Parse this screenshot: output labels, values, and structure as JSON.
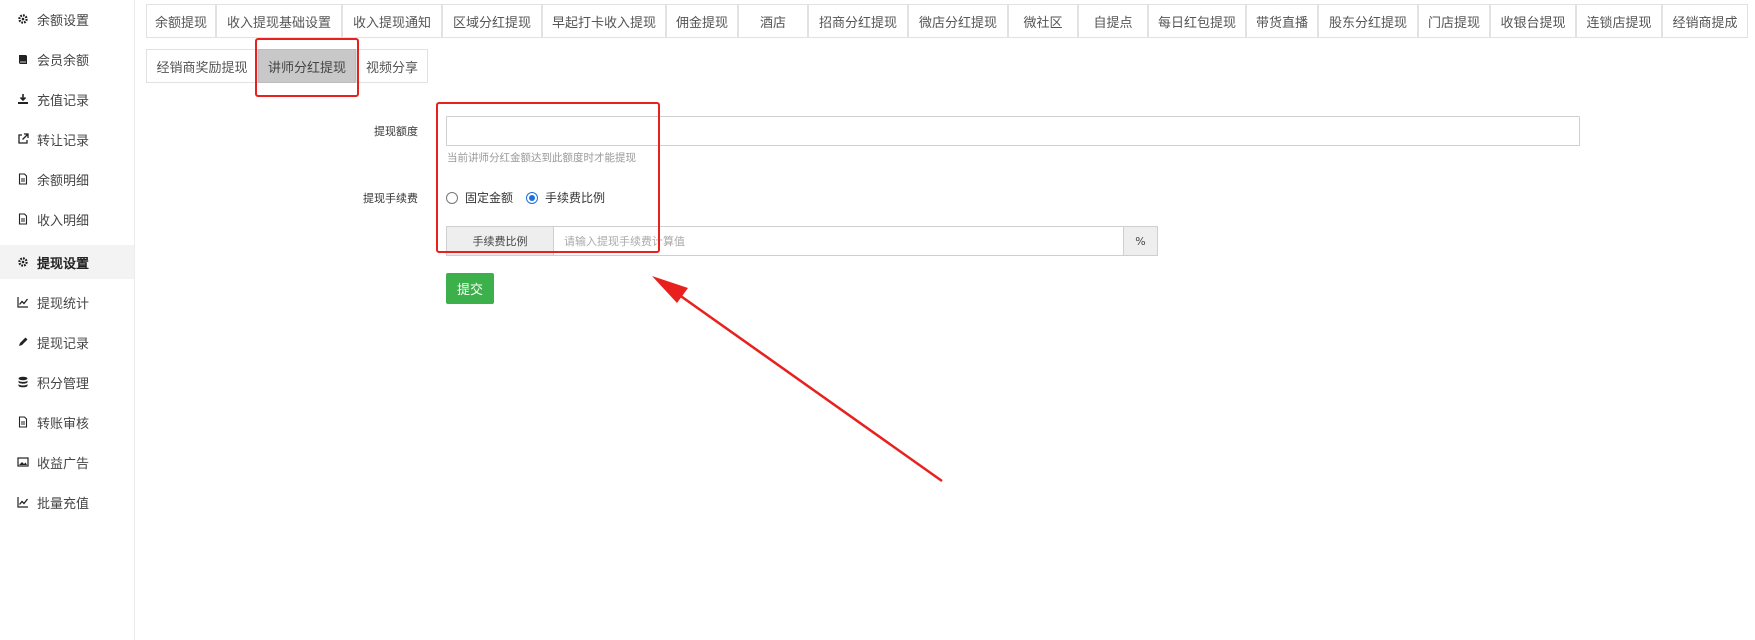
{
  "sidebar": {
    "items": [
      {
        "label": "余额设置",
        "icon": "gear-icon"
      },
      {
        "label": "会员余额",
        "icon": "book-icon"
      },
      {
        "label": "充值记录",
        "icon": "download-icon"
      },
      {
        "label": "转让记录",
        "icon": "external-link-icon"
      },
      {
        "label": "余额明细",
        "icon": "document-icon"
      },
      {
        "label": "收入明细",
        "icon": "document-icon"
      },
      {
        "label": "提现设置",
        "icon": "gear-icon"
      },
      {
        "label": "提现统计",
        "icon": "line-chart-icon"
      },
      {
        "label": "提现记录",
        "icon": "pencil-icon"
      },
      {
        "label": "积分管理",
        "icon": "database-icon"
      },
      {
        "label": "转账审核",
        "icon": "document-icon"
      },
      {
        "label": "收益广告",
        "icon": "image-icon"
      },
      {
        "label": "批量充值",
        "icon": "line-chart-icon"
      }
    ]
  },
  "tabs": {
    "row1": [
      "余额提现",
      "收入提现基础设置",
      "收入提现通知",
      "区域分红提现",
      "早起打卡收入提现",
      "佣金提现",
      "酒店",
      "招商分红提现",
      "微店分红提现",
      "微社区",
      "自提点",
      "每日红包提现",
      "带货直播",
      "股东分红提现",
      "门店提现",
      "收银台提现",
      "连锁店提现",
      "经销商提成"
    ],
    "row2": [
      "经销商奖励提现",
      "讲师分红提现",
      "视频分享"
    ]
  },
  "form": {
    "quota_label": "提现额度",
    "quota_value": "",
    "quota_hint": "当前讲师分红金额达到此额度时才能提现",
    "fee_label": "提现手续费",
    "fee_options": [
      "固定金额",
      "手续费比例"
    ],
    "fee_rate_addon": "手续费比例",
    "fee_rate_placeholder": "请输入提现手续费计算值",
    "fee_rate_unit": "%",
    "submit_label": "提交"
  },
  "colors": {
    "annotation": "#e8201e",
    "submit": "#3cb04a",
    "radio_checked": "#1b6fe0"
  }
}
